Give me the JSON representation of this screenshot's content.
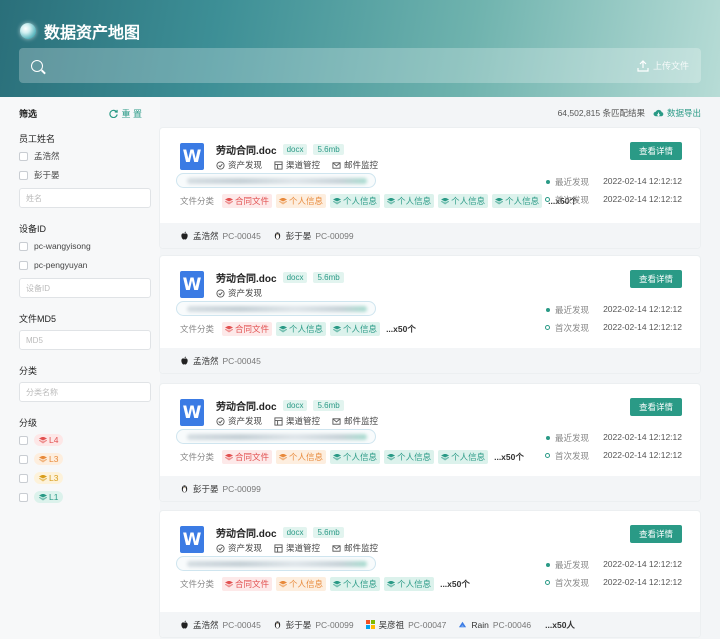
{
  "app": {
    "title": "数据资产地图"
  },
  "search": {
    "placeholder": "",
    "upload_label": "上传文件"
  },
  "sidebar": {
    "title": "筛选",
    "reset_label": "重 置",
    "employee": {
      "label": "员工姓名",
      "options": [
        "孟浩然",
        "彭于晏"
      ],
      "input_placeholder": "姓名"
    },
    "device": {
      "label": "设备ID",
      "options": [
        "pc-wangyisong",
        "pc-pengyuyan"
      ],
      "input_placeholder": "设备ID"
    },
    "md5": {
      "label": "文件MD5",
      "input_placeholder": "MD5"
    },
    "category": {
      "label": "分类",
      "input_placeholder": "分类名称"
    },
    "level": {
      "label": "分级",
      "options": [
        "L4",
        "L3",
        "L3",
        "L1"
      ]
    }
  },
  "results": {
    "count_text": "64,502,815 条匹配结果",
    "export_label": "数据导出"
  },
  "common": {
    "detail_button": "查看详情",
    "last_found_label": "最近发现",
    "first_found_label": "首次发现",
    "class_label": "文件分类",
    "tag_contract": "合同文件",
    "tag_personal": "个人信息"
  },
  "cards": [
    {
      "filename": "劳动合同.doc",
      "ext": "docx",
      "size": "5.6mb",
      "channels": [
        "资产发现",
        "渠道管控",
        "邮件监控"
      ],
      "last_found": "2022-02-14 12:12:12",
      "first_found": "2022-02-14 12:12:12",
      "more": "...x50个",
      "devices": [
        {
          "name": "孟浩然",
          "code": "PC-00045",
          "os": "apple"
        },
        {
          "name": "彭于晏",
          "code": "PC-00099",
          "os": "linux"
        }
      ],
      "devices_more": ""
    },
    {
      "filename": "劳动合同.doc",
      "ext": "docx",
      "size": "5.6mb",
      "channels": [
        "资产发现"
      ],
      "last_found": "2022-02-14 12:12:12",
      "first_found": "2022-02-14 12:12:12",
      "more": "...x50个",
      "devices": [
        {
          "name": "孟浩然",
          "code": "PC-00045",
          "os": "apple"
        }
      ],
      "devices_more": ""
    },
    {
      "filename": "劳动合同.doc",
      "ext": "docx",
      "size": "5.6mb",
      "channels": [
        "资产发现",
        "渠道管控",
        "邮件监控"
      ],
      "last_found": "2022-02-14 12:12:12",
      "first_found": "2022-02-14 12:12:12",
      "more": "...x50个",
      "devices": [
        {
          "name": "彭于晏",
          "code": "PC-00099",
          "os": "linux"
        }
      ],
      "devices_more": ""
    },
    {
      "filename": "劳动合同.doc",
      "ext": "docx",
      "size": "5.6mb",
      "channels": [
        "资产发现",
        "渠道管控",
        "邮件监控"
      ],
      "last_found": "2022-02-14 12:12:12",
      "first_found": "2022-02-14 12:12:12",
      "more": "...x50个",
      "devices": [
        {
          "name": "孟浩然",
          "code": "PC-00045",
          "os": "apple"
        },
        {
          "name": "彭于晏",
          "code": "PC-00099",
          "os": "linux"
        },
        {
          "name": "吴彦祖",
          "code": "PC-00047",
          "os": "windows"
        },
        {
          "name": "Rain",
          "code": "PC-00046",
          "os": "fedora"
        }
      ],
      "devices_more": "...x50人"
    }
  ],
  "colors": {
    "accent": "#2a9a86",
    "header_start": "#2a6f7a",
    "header_end": "#b7dcd6",
    "doc_blue": "#3b7be4",
    "danger": "#e25252",
    "warning": "#e88a3b"
  }
}
